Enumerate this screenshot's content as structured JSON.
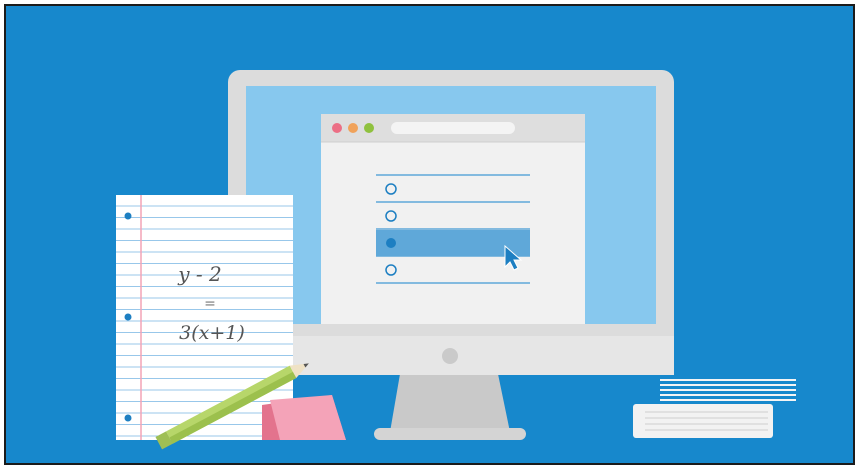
{
  "illustration": {
    "worksheet": {
      "handwriting_line1": "y - 2",
      "handwriting_line2": "=",
      "handwriting_line3": "3(x+1)"
    },
    "browser": {
      "quiz_options": [
        {
          "selected": false
        },
        {
          "selected": false
        },
        {
          "selected": true
        },
        {
          "selected": false
        }
      ]
    }
  },
  "colors": {
    "background": "#1788cc",
    "border": "#1b1b1b",
    "monitor_frame": "#dcdcdc",
    "monitor_chin": "#e6e6e6",
    "screen": "#87c8ee",
    "window": "#f1f1f1",
    "window_toolbar": "#dedede",
    "dot_red": "#ec6f85",
    "dot_orange": "#f0a25a",
    "dot_green": "#8fc13e",
    "selected_row": "#5fa8d9",
    "radio": "#1d7fc2",
    "cursor": "#1d7fc2",
    "paper": "#ffffff",
    "paper_lines": "#98c7ea",
    "paper_margin": "#f3a3b6",
    "pencil_body": "#b7d66a",
    "eraser_top": "#f4a3b8",
    "eraser_side": "#e3738d",
    "books": "#f2f2f2"
  }
}
